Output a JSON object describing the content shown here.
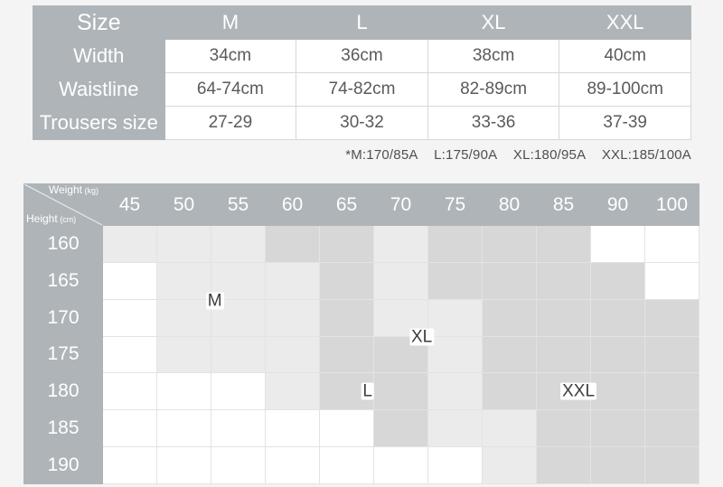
{
  "size_table": {
    "header_row": [
      "Size",
      "M",
      "L",
      "XL",
      "XXL"
    ],
    "rows": [
      {
        "label": "Width",
        "values": [
          "34cm",
          "36cm",
          "38cm",
          "40cm"
        ]
      },
      {
        "label": "Waistline",
        "values": [
          "64-74cm",
          "74-82cm",
          "82-89cm",
          "89-100cm"
        ]
      },
      {
        "label": "Trousers size",
        "values": [
          "27-29",
          "30-32",
          "33-36",
          "37-39"
        ]
      }
    ]
  },
  "footnote": {
    "items": [
      "*M:170/85A",
      "L:175/90A",
      "XL:180/95A",
      "XXL:185/100A"
    ]
  },
  "matrix": {
    "corner": {
      "weight_label": "Weight",
      "weight_unit": "(kg)",
      "height_label": "Height",
      "height_unit": "(cm)"
    },
    "weights": [
      "45",
      "50",
      "55",
      "60",
      "65",
      "70",
      "75",
      "80",
      "85",
      "90",
      "100"
    ],
    "heights": [
      "160",
      "165",
      "170",
      "175",
      "180",
      "185",
      "190"
    ],
    "cells": [
      [
        "l",
        "l",
        "l",
        "d",
        "d",
        "l",
        "d",
        "d",
        "d",
        "w",
        "w"
      ],
      [
        "w",
        "l",
        "l",
        "l",
        "d",
        "l",
        "d",
        "d",
        "d",
        "d",
        "w"
      ],
      [
        "w",
        "l",
        "l",
        "l",
        "d",
        "l",
        "l",
        "d",
        "d",
        "d",
        "d"
      ],
      [
        "w",
        "l",
        "l",
        "l",
        "d",
        "d",
        "l",
        "d",
        "d",
        "d",
        "d"
      ],
      [
        "w",
        "w",
        "w",
        "l",
        "d",
        "d",
        "l",
        "d",
        "d",
        "d",
        "d"
      ],
      [
        "w",
        "w",
        "w",
        "w",
        "w",
        "d",
        "l",
        "l",
        "d",
        "d",
        "d"
      ],
      [
        "w",
        "w",
        "w",
        "w",
        "w",
        "w",
        "w",
        "l",
        "d",
        "d",
        "d"
      ]
    ],
    "markers": [
      {
        "label": "M",
        "left_pct": 28.3,
        "top_pct": 39.0
      },
      {
        "label": "XL",
        "left_pct": 58.9,
        "top_pct": 51.0
      },
      {
        "label": "L",
        "left_pct": 50.9,
        "top_pct": 69.1
      },
      {
        "label": "XXL",
        "left_pct": 82.1,
        "top_pct": 69.1
      }
    ]
  },
  "colors": {
    "background": "#f4f4f4",
    "header_gray": "#aeb4b8",
    "cell_light": "#ebebeb",
    "cell_dark": "#d7d7d7",
    "cell_white": "#ffffff",
    "text": "#5a5a5a"
  }
}
